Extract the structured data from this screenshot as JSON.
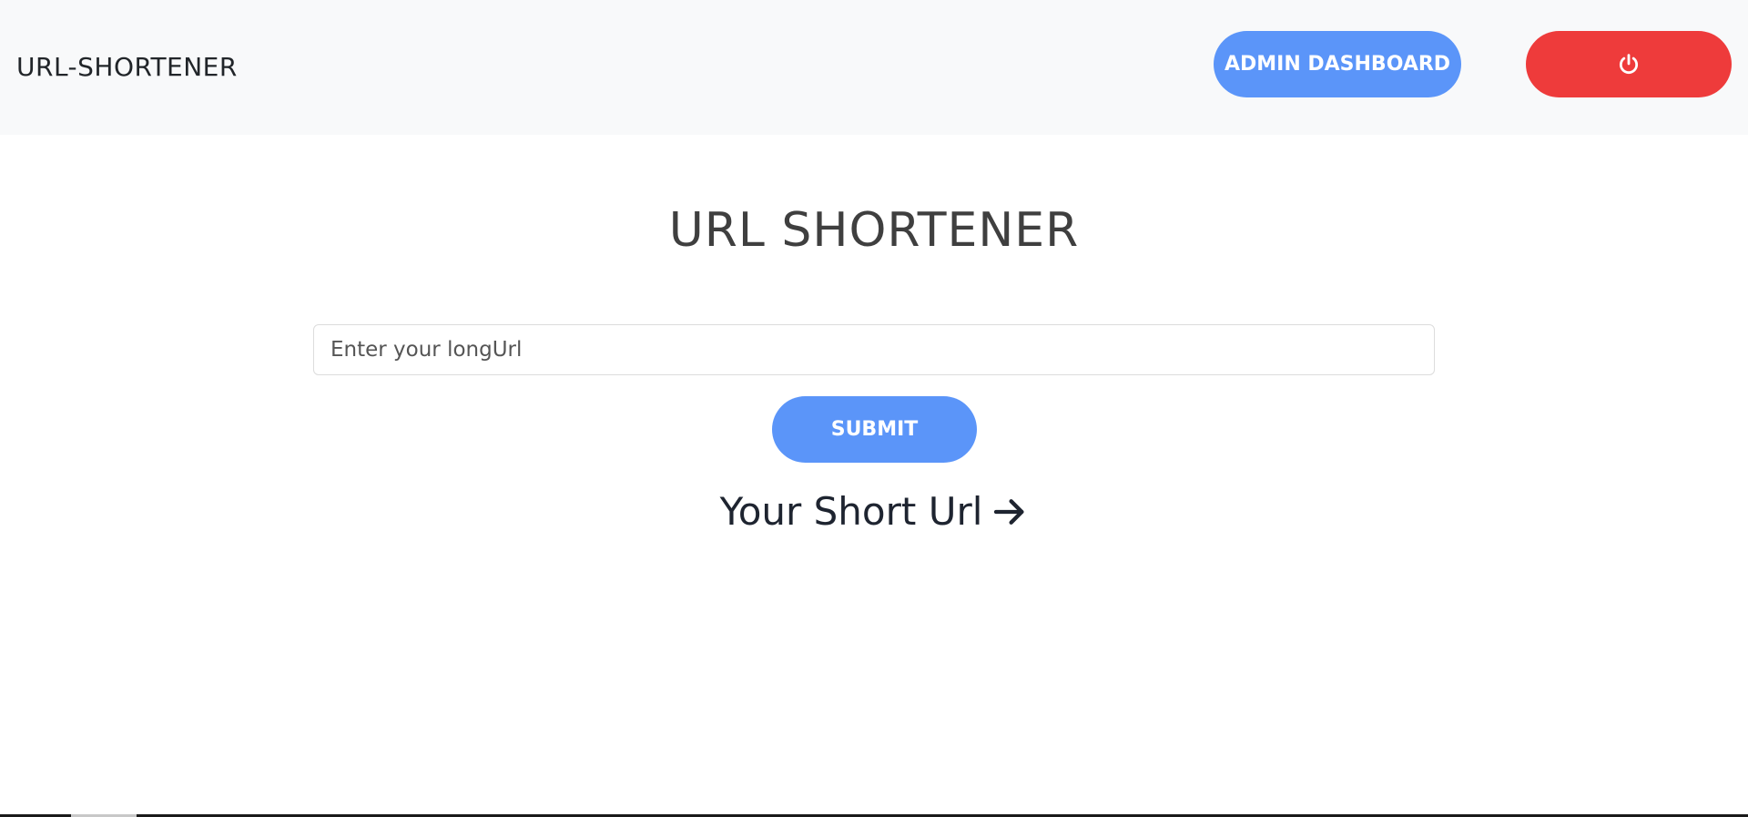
{
  "navbar": {
    "brand": "URL-SHORTENER",
    "admin_button_label": "ADMIN DASHBOARD",
    "logout_icon": "power-icon"
  },
  "main": {
    "title": "URL SHORTENER",
    "input": {
      "placeholder": "Enter your longUrl",
      "value": ""
    },
    "submit_label": "SUBMIT",
    "short_url_label": "Your Short Url",
    "short_url_icon": "arrow-right-icon"
  },
  "colors": {
    "primary": "#5b95f9",
    "danger": "#ee3b3b",
    "navbar_bg": "#f8f9fa",
    "title_text": "#3f3f3f"
  }
}
